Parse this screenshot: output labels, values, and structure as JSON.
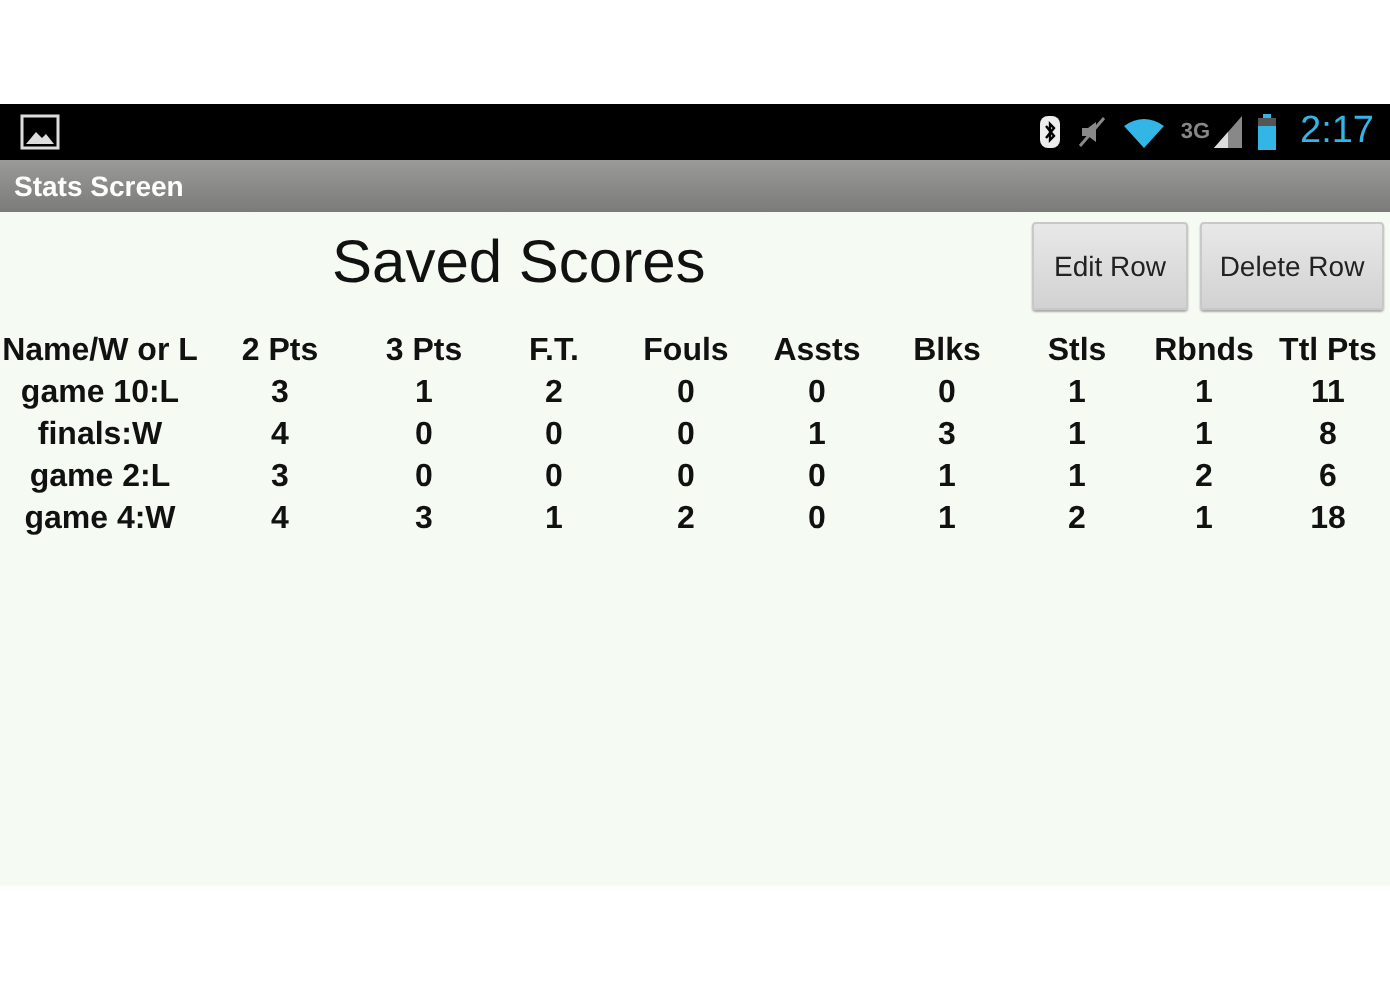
{
  "status_bar": {
    "network": "3G",
    "time": "2:17"
  },
  "title_bar": {
    "title": "Stats Screen"
  },
  "heading": "Saved Scores",
  "buttons": [
    "Edit Row",
    "Delete Row"
  ],
  "table": {
    "columns": [
      "Name/W or L",
      "2 Pts",
      "3 Pts",
      "F.T.",
      "Fouls",
      "Assts",
      "Blks",
      "Stls",
      "Rbnds",
      "Ttl Pts"
    ],
    "rows": [
      [
        "game 10:L",
        "3",
        "1",
        "2",
        "0",
        "0",
        "0",
        "1",
        "1",
        "11"
      ],
      [
        "finals:W",
        "4",
        "0",
        "0",
        "0",
        "1",
        "3",
        "1",
        "1",
        "8"
      ],
      [
        "game 2:L",
        "3",
        "0",
        "0",
        "0",
        "0",
        "1",
        "1",
        "2",
        "6"
      ],
      [
        "game 4:W",
        "4",
        "3",
        "1",
        "2",
        "0",
        "1",
        "2",
        "1",
        "18"
      ]
    ]
  }
}
